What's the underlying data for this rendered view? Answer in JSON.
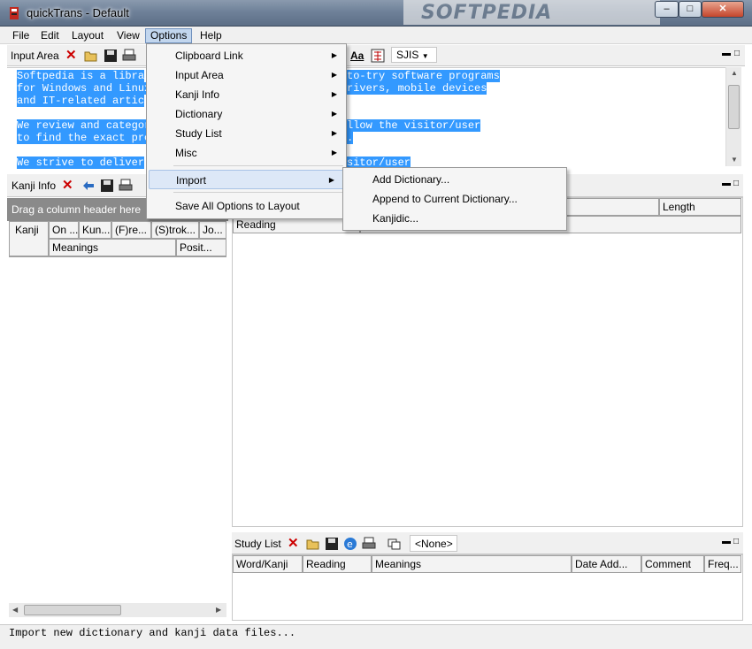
{
  "window": {
    "title": "quickTrans - Default",
    "watermark": "SOFTPEDIA"
  },
  "menubar": {
    "items": [
      "File",
      "Edit",
      "Layout",
      "View",
      "Options",
      "Help"
    ],
    "active": "Options"
  },
  "input_area": {
    "title": "Input Area",
    "encoding": "SJIS",
    "lines": [
      {
        "left": "Softpedia is a libra",
        "right": "to-try software programs"
      },
      {
        "left": "for Windows and Linux",
        "right": "rivers, mobile devices"
      },
      {
        "left": "and IT-related artic",
        "right": ""
      },
      {
        "left": "",
        "right": ""
      },
      {
        "left": "We review and categor",
        "right": "llow the visitor/user"
      },
      {
        "left": "to find the exact pro",
        "right": "."
      },
      {
        "left": "",
        "right": ""
      },
      {
        "left": "We strive to deliver",
        "right": "sitor/user"
      }
    ]
  },
  "kanji_info": {
    "title": "Kanji Info",
    "group_hint": "Drag a column header here",
    "columns_row1": [
      "Kanji",
      "On ...",
      "Kun...",
      "(F)re...",
      "(S)trok...",
      "Jo..."
    ],
    "columns_row2": [
      "Meanings",
      "Posit..."
    ]
  },
  "dict_panel": {
    "columns": [
      "Length"
    ],
    "columns_row2": [
      "Reading"
    ]
  },
  "study_list": {
    "title": "Study List",
    "selector": "<None>",
    "columns": [
      "Word/Kanji",
      "Reading",
      "Meanings",
      "Date Add...",
      "Comment",
      "Freq..."
    ]
  },
  "options_menu": {
    "items": [
      {
        "label": "Clipboard Link",
        "submenu": true
      },
      {
        "label": "Input Area",
        "submenu": true
      },
      {
        "label": "Kanji Info",
        "submenu": true
      },
      {
        "label": "Dictionary",
        "submenu": true
      },
      {
        "label": "Study List",
        "submenu": true
      },
      {
        "label": "Misc",
        "submenu": true
      },
      {
        "label": "Import",
        "submenu": true
      },
      {
        "label": "Save All Options to Layout",
        "submenu": false
      }
    ]
  },
  "import_submenu": {
    "items": [
      "Add Dictionary...",
      "Append to Current Dictionary...",
      "Kanjidic..."
    ]
  },
  "status": {
    "text": "Import new dictionary and kanji data files..."
  }
}
